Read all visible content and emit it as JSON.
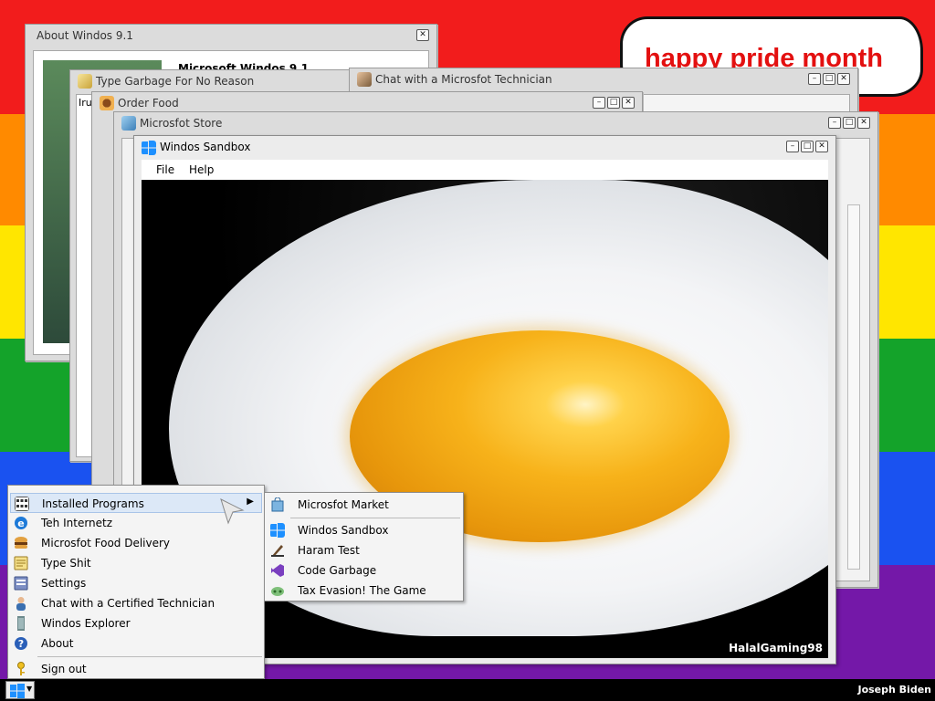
{
  "wallpaper": {
    "speech": "happy pride month"
  },
  "windows": {
    "about": {
      "title": "About Windos 9.1",
      "partial_text": "Microsoft Windos 9.1"
    },
    "type_garbage": {
      "title": "Type Garbage For No Reason",
      "partial_text": "Iru"
    },
    "chat": {
      "title": "Chat with a Microsfot Technician"
    },
    "order_food": {
      "title": "Order Food"
    },
    "store": {
      "title": "Microsfot Store"
    },
    "sandbox": {
      "title": "Windos Sandbox",
      "menu": [
        "File",
        "Help"
      ],
      "image_watermark": "HalalGaming98"
    }
  },
  "start_menu": {
    "items": [
      {
        "label": "Installed Programs",
        "icon": "programs-grid-icon",
        "has_submenu": true,
        "highlighted": true
      },
      {
        "label": "Teh Internetz",
        "icon": "internet-explorer-icon"
      },
      {
        "label": "Microsfot Food Delivery",
        "icon": "burger-icon"
      },
      {
        "label": "Type Shit",
        "icon": "notepad-icon"
      },
      {
        "label": "Settings",
        "icon": "settings-icon"
      },
      {
        "label": "Chat with a Certified Technician",
        "icon": "technician-icon"
      },
      {
        "label": "Windos Explorer",
        "icon": "explorer-icon"
      },
      {
        "label": "About",
        "icon": "help-icon"
      },
      {
        "label": "Sign out",
        "icon": "key-icon"
      }
    ]
  },
  "submenu": {
    "items": [
      {
        "label": "Microsfot Market",
        "icon": "store-bag-icon"
      },
      {
        "label": "Windos Sandbox",
        "icon": "windows-logo-icon"
      },
      {
        "label": "Haram Test",
        "icon": "pen-icon"
      },
      {
        "label": "Code Garbage",
        "icon": "visual-studio-icon"
      },
      {
        "label": "Tax Evasion! The Game",
        "icon": "game-icon"
      }
    ]
  },
  "taskbar": {
    "user": "Joseph Biden",
    "start_icon": "windows-logo-icon"
  },
  "colors": {
    "flag": [
      "#f21c1c",
      "#ff8a00",
      "#ffe600",
      "#14a32a",
      "#1a52f0",
      "#7418a8"
    ],
    "speech_text": "#e31010",
    "menu_highlight": "#dce8f7"
  }
}
